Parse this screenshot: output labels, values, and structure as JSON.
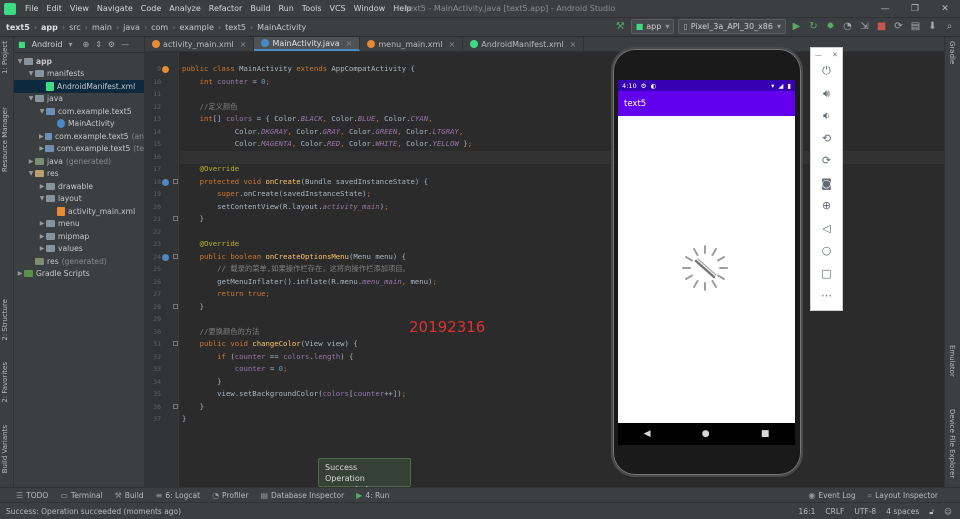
{
  "menubar": {
    "items": [
      "File",
      "Edit",
      "View",
      "Navigate",
      "Code",
      "Analyze",
      "Refactor",
      "Build",
      "Run",
      "Tools",
      "VCS",
      "Window",
      "Help"
    ],
    "window_title": "text5 - MainActivity.java [text5.app] - Android Studio"
  },
  "breadcrumb": [
    "text5",
    "app",
    "src",
    "main",
    "java",
    "com",
    "example",
    "text5",
    "MainActivity"
  ],
  "run_config": "app",
  "device": "Pixel_3a_API_30_x86",
  "left_tabs": [
    "1: Project",
    "Resource Manager",
    "2: Structure",
    "2: Favorites",
    "Build Variants"
  ],
  "right_tabs": [
    "Gradle",
    "Emulator",
    "Device File Explorer"
  ],
  "project": {
    "view_mode": "Android",
    "tree": [
      {
        "label": "app",
        "depth": 0,
        "arrow": "▼",
        "icon": "fold blue",
        "bold": true
      },
      {
        "label": "manifests",
        "depth": 1,
        "arrow": "▼",
        "icon": "fold blue"
      },
      {
        "label": "AndroidManifest.xml",
        "depth": 2,
        "arrow": "",
        "icon": "file-xml",
        "selected": true
      },
      {
        "label": "java",
        "depth": 1,
        "arrow": "▼",
        "icon": "fold blue"
      },
      {
        "label": "com.example.text5",
        "depth": 2,
        "arrow": "▼",
        "icon": "fold pkg"
      },
      {
        "label": "MainActivity",
        "depth": 3,
        "arrow": "",
        "icon": "file-class"
      },
      {
        "label": "com.example.text5",
        "suffix": "(an",
        "depth": 2,
        "arrow": "▶",
        "icon": "fold pkg"
      },
      {
        "label": "com.example.text5",
        "suffix": "(te",
        "depth": 2,
        "arrow": "▶",
        "icon": "fold pkg"
      },
      {
        "label": "java",
        "suffix": "(generated)",
        "depth": 1,
        "arrow": "▶",
        "icon": "fold gen"
      },
      {
        "label": "res",
        "depth": 1,
        "arrow": "▼",
        "icon": "fold res"
      },
      {
        "label": "drawable",
        "depth": 2,
        "arrow": "▶",
        "icon": "fold blue"
      },
      {
        "label": "layout",
        "depth": 2,
        "arrow": "▼",
        "icon": "fold blue"
      },
      {
        "label": "activity_main.xml",
        "depth": 3,
        "arrow": "",
        "icon": "file-layout"
      },
      {
        "label": "menu",
        "depth": 2,
        "arrow": "▶",
        "icon": "fold blue"
      },
      {
        "label": "mipmap",
        "depth": 2,
        "arrow": "▶",
        "icon": "fold blue"
      },
      {
        "label": "values",
        "depth": 2,
        "arrow": "▶",
        "icon": "fold blue"
      },
      {
        "label": "res",
        "suffix": "(generated)",
        "depth": 1,
        "arrow": "",
        "icon": "fold gen"
      },
      {
        "label": "Gradle Scripts",
        "depth": 0,
        "arrow": "▶",
        "icon": "fold gradle"
      }
    ]
  },
  "editor_tabs": [
    {
      "label": "activity_main.xml",
      "color": "#e38b35",
      "active": false
    },
    {
      "label": "MainActivity.java",
      "color": "#4a88c7",
      "active": true
    },
    {
      "label": "menu_main.xml",
      "color": "#e38b35",
      "active": false
    },
    {
      "label": "AndroidManifest.xml",
      "color": "#3ddc84",
      "active": false
    }
  ],
  "code_lines": [
    {
      "n": "9",
      "html": "<span class='kw'>public class </span><span class='cls'>MainActivity </span><span class='kw'>extends </span><span class='cls'>AppCompatActivity {</span>"
    },
    {
      "n": "10",
      "html": "    <span class='kw'>int </span><span class='fld'>counter </span><span class='txt'>= </span><span class='num'>0</span><span class='kw'>;</span>"
    },
    {
      "n": "11",
      "html": ""
    },
    {
      "n": "12",
      "html": "    <span class='cmt'>//定义颜色</span>"
    },
    {
      "n": "13",
      "html": "    <span class='kw'>int</span><span class='txt'>[] </span><span class='fld'>colors </span><span class='txt'>= { Color.</span><span class='sfld'>BLACK</span><span class='kw'>, </span><span class='txt'>Color.</span><span class='sfld'>BLUE</span><span class='kw'>, </span><span class='txt'>Color.</span><span class='sfld'>CYAN</span><span class='kw'>,</span>"
    },
    {
      "n": "14",
      "html": "            <span class='txt'>Color.</span><span class='sfld'>DKGRAY</span><span class='kw'>, </span><span class='txt'>Color.</span><span class='sfld'>GRAY</span><span class='kw'>, </span><span class='txt'>Color.</span><span class='sfld'>GREEN</span><span class='kw'>, </span><span class='txt'>Color.</span><span class='sfld'>LTGRAY</span><span class='kw'>,</span>"
    },
    {
      "n": "15",
      "html": "            <span class='txt'>Color.</span><span class='sfld'>MAGENTA</span><span class='kw'>, </span><span class='txt'>Color.</span><span class='sfld'>RED</span><span class='kw'>, </span><span class='txt'>Color.</span><span class='sfld'>WHITE</span><span class='kw'>, </span><span class='txt'>Color.</span><span class='sfld'>YELLOW </span><span class='txt'>}</span><span class='kw'>;</span>"
    },
    {
      "n": "16",
      "html": ""
    },
    {
      "n": "17",
      "html": "    <span class='ann'>@Override</span>"
    },
    {
      "n": "18",
      "html": "    <span class='kw'>protected void </span><span class='mth'>onCreate</span><span class='txt'>(Bundle savedInstanceState) {</span>"
    },
    {
      "n": "19",
      "html": "        <span class='kw'>super</span><span class='txt'>.onCreate(savedInstanceState)</span><span class='kw'>;</span>"
    },
    {
      "n": "20",
      "html": "        <span class='txt'>setContentView(R.layout.</span><span class='sfld'>activity_main</span><span class='txt'>)</span><span class='kw'>;</span>"
    },
    {
      "n": "21",
      "html": "    <span class='txt'>}</span>"
    },
    {
      "n": "22",
      "html": ""
    },
    {
      "n": "23",
      "html": "    <span class='ann'>@Override</span>"
    },
    {
      "n": "24",
      "html": "    <span class='kw'>public boolean </span><span class='mth'>onCreateOptionsMenu</span><span class='txt'>(Menu menu) {</span>"
    },
    {
      "n": "25",
      "html": "        <span class='cmt'>// 载录的菜单,如果操作栏存在，这将向操作栏添加项目。</span>"
    },
    {
      "n": "26",
      "html": "        <span class='txt'>getMenuInflater().inflate(R.menu.</span><span class='sfld'>menu_main</span><span class='kw'>, </span><span class='txt'>menu)</span><span class='kw'>;</span>"
    },
    {
      "n": "27",
      "html": "        <span class='kw'>return true;</span>"
    },
    {
      "n": "28",
      "html": "    <span class='txt'>}</span>"
    },
    {
      "n": "29",
      "html": ""
    },
    {
      "n": "30",
      "html": "    <span class='cmt'>//更换颜色的方法</span>"
    },
    {
      "n": "31",
      "html": "    <span class='kw'>public void </span><span class='mth'>changeColor</span><span class='txt'>(View view) {</span>"
    },
    {
      "n": "32",
      "html": "        <span class='kw'>if </span><span class='txt'>(</span><span class='fld'>counter </span><span class='txt'>== </span><span class='fld'>colors</span><span class='txt'>.</span><span class='fld'>length</span><span class='txt'>) {</span>"
    },
    {
      "n": "33",
      "html": "            <span class='fld'>counter </span><span class='txt'>= </span><span class='num'>0</span><span class='kw'>;</span>"
    },
    {
      "n": "34",
      "html": "        <span class='txt'>}</span>"
    },
    {
      "n": "35",
      "html": "        <span class='txt'>view.setBackgroundColor(</span><span class='fld'>colors</span><span class='txt'>[</span><span class='fld'>counter</span><span class='txt'>++])</span><span class='kw'>;</span>"
    },
    {
      "n": "36",
      "html": "    <span class='txt'>}</span>"
    },
    {
      "n": "37",
      "html": "<span class='txt'>}</span>"
    }
  ],
  "watermark_text": "20192316",
  "phone": {
    "time": "4:10",
    "app_title": "text5"
  },
  "notification": {
    "title": "Success",
    "message": "Operation succeeded"
  },
  "tool_windows": [
    "TODO",
    "Terminal",
    "Build",
    "6: Logcat",
    "Profiler",
    "Database Inspector",
    "4: Run"
  ],
  "tool_windows_right": [
    "Event Log",
    "Layout Inspector"
  ],
  "status": {
    "message": "Success: Operation succeeded (moments ago)",
    "position": "16:1",
    "line_sep": "CRLF",
    "encoding": "UTF-8",
    "indent": "4 spaces"
  }
}
